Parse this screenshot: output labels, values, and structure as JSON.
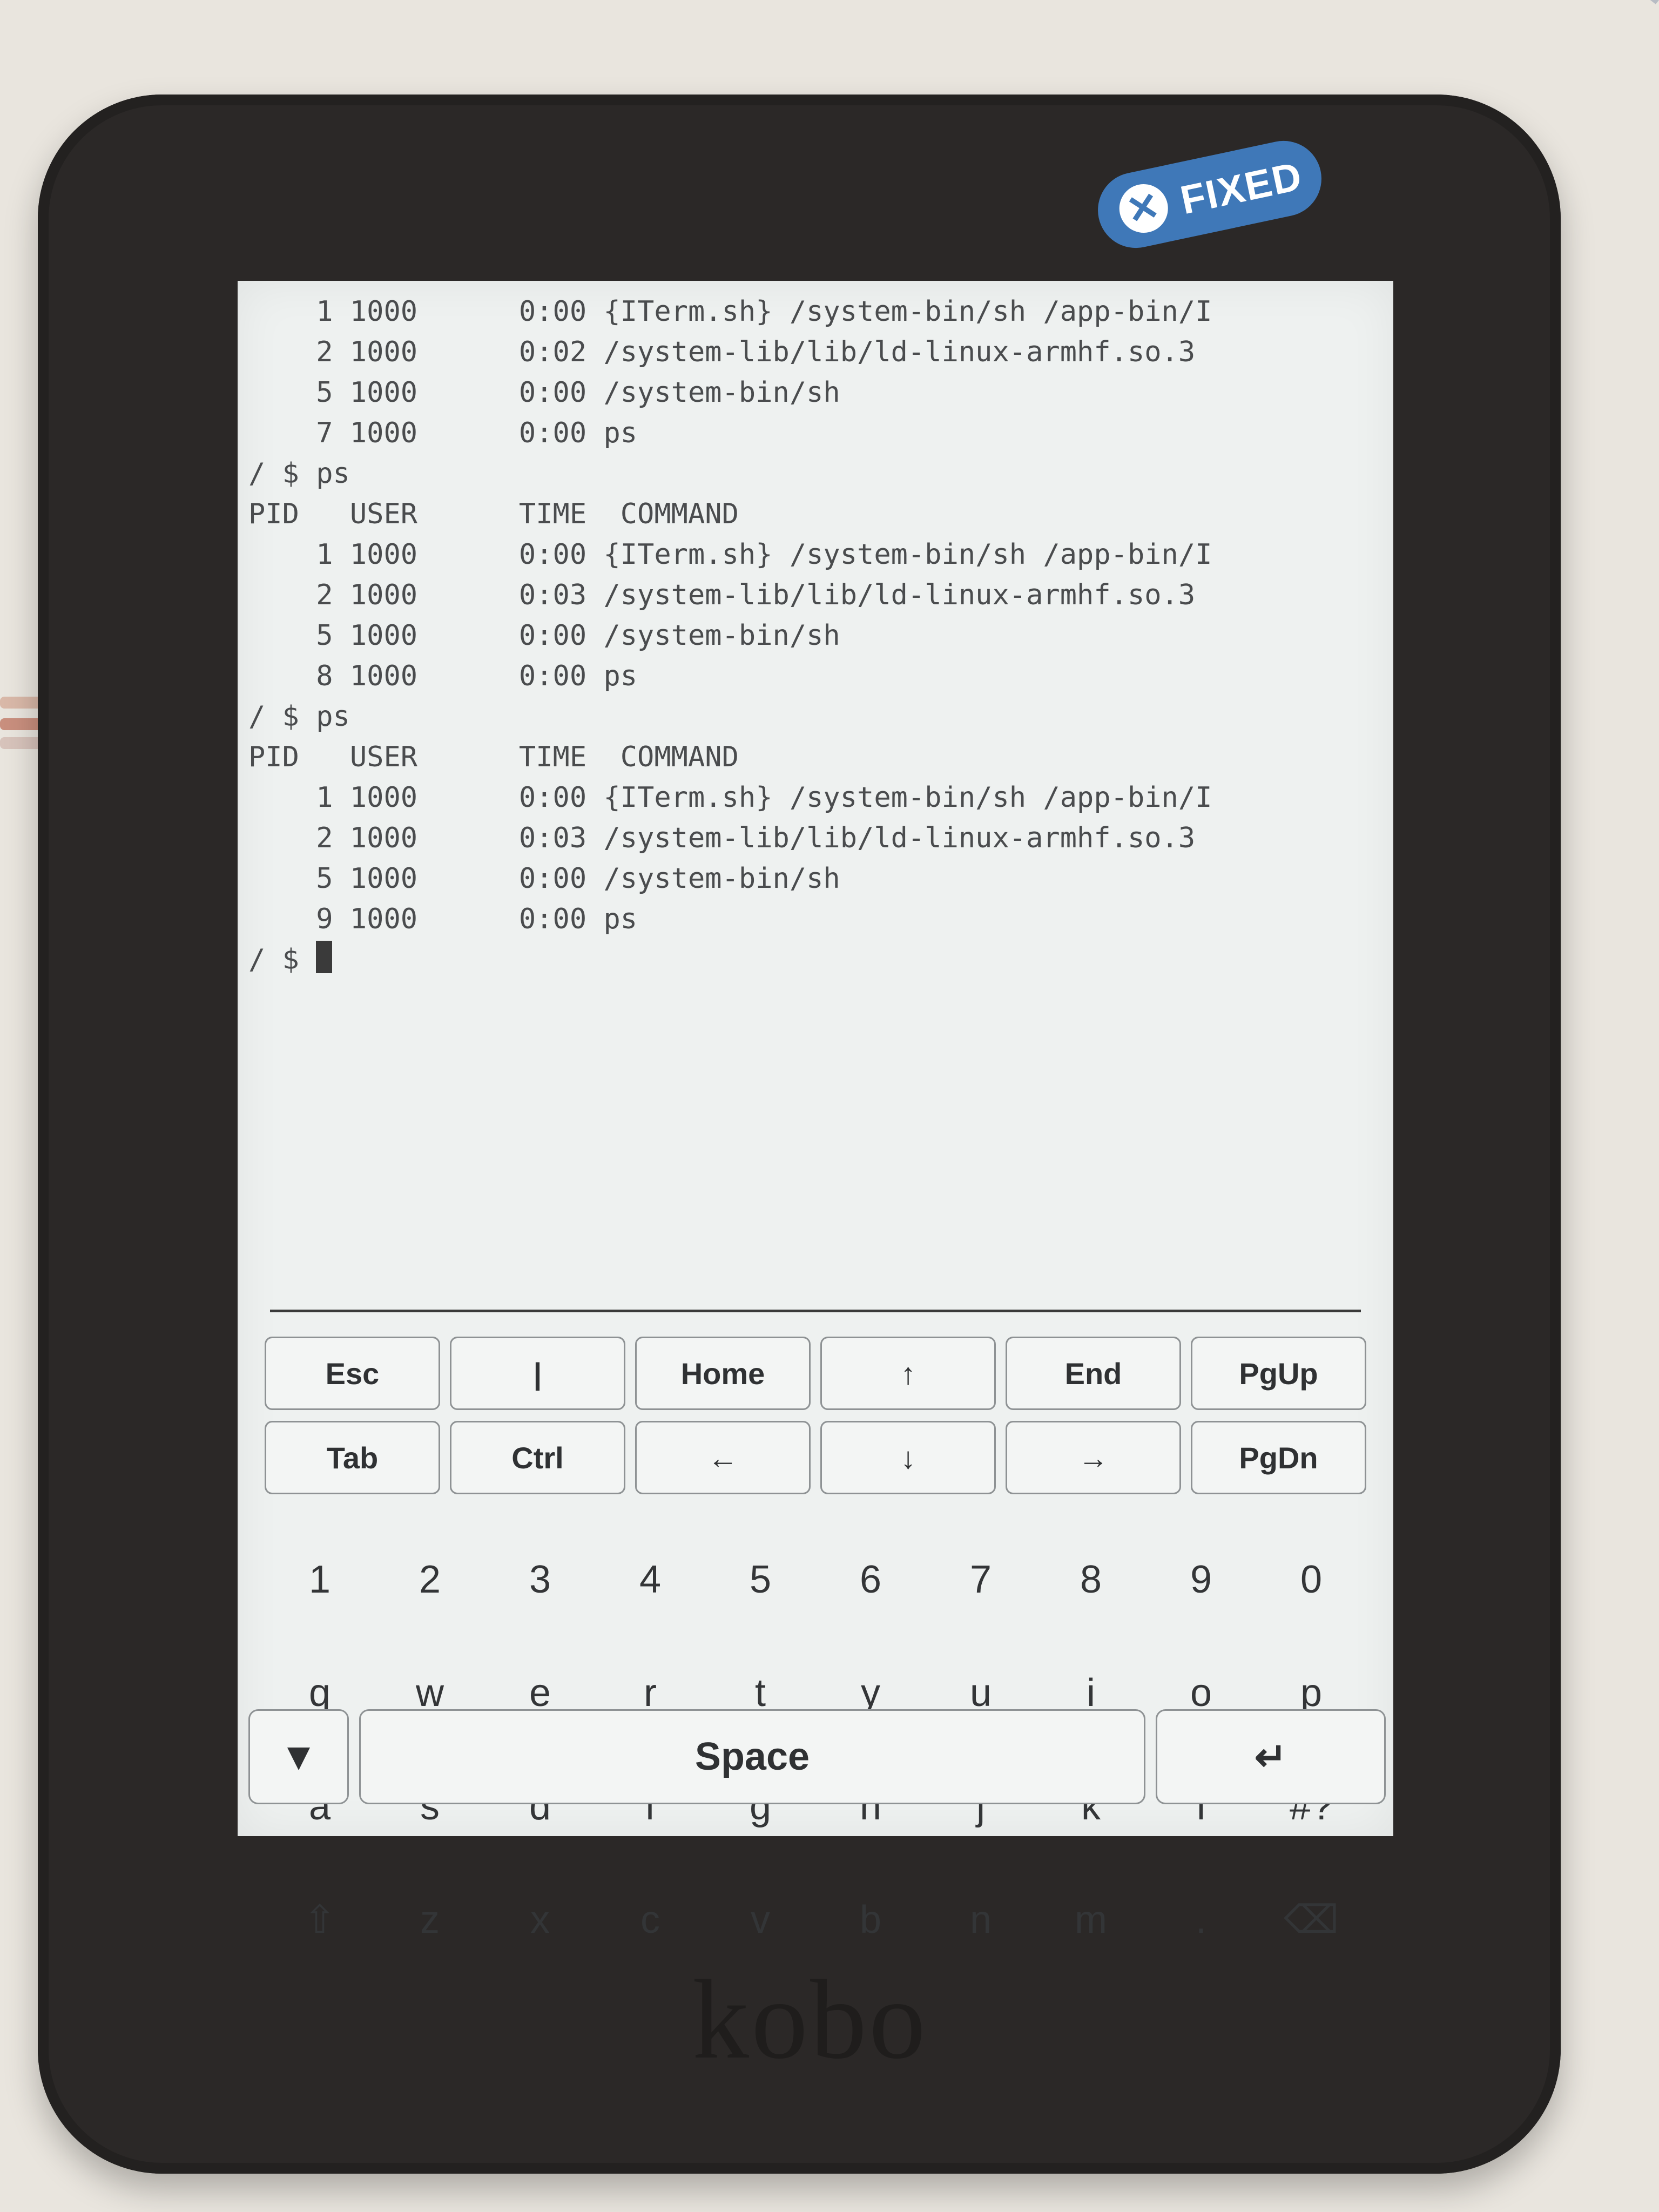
{
  "device": {
    "sticker_label": "FIXED",
    "sticker_icon": "x-circle-icon",
    "brand": "kobo"
  },
  "terminal": {
    "lines": [
      "    1 1000      0:00 {ITerm.sh} /system-bin/sh /app-bin/I",
      "    2 1000      0:02 /system-lib/lib/ld-linux-armhf.so.3",
      "    5 1000      0:00 /system-bin/sh",
      "    7 1000      0:00 ps",
      "/ $ ps",
      "PID   USER      TIME  COMMAND",
      "    1 1000      0:00 {ITerm.sh} /system-bin/sh /app-bin/I",
      "    2 1000      0:03 /system-lib/lib/ld-linux-armhf.so.3",
      "    5 1000      0:00 /system-bin/sh",
      "    8 1000      0:00 ps",
      "/ $ ps",
      "PID   USER      TIME  COMMAND",
      "    1 1000      0:00 {ITerm.sh} /system-bin/sh /app-bin/I",
      "    2 1000      0:03 /system-lib/lib/ld-linux-armhf.so.3",
      "    5 1000      0:00 /system-bin/sh",
      "    9 1000      0:00 ps"
    ],
    "prompt": "/ $ "
  },
  "keyboard": {
    "special_keys": [
      "Esc",
      "|",
      "Home",
      "↑",
      "End",
      "PgUp",
      "Tab",
      "Ctrl",
      "←",
      "↓",
      "→",
      "PgDn"
    ],
    "rows": [
      [
        "1",
        "2",
        "3",
        "4",
        "5",
        "6",
        "7",
        "8",
        "9",
        "0"
      ],
      [
        "q",
        "w",
        "e",
        "r",
        "t",
        "y",
        "u",
        "i",
        "o",
        "p"
      ],
      [
        "a",
        "s",
        "d",
        "f",
        "g",
        "h",
        "j",
        "k",
        "l",
        "#?"
      ],
      [
        "⇧",
        "z",
        "x",
        "c",
        "v",
        "b",
        "n",
        "m",
        ".",
        "⌫"
      ]
    ],
    "hide_key": "▼",
    "space_label": "Space",
    "enter_key": "↵"
  }
}
